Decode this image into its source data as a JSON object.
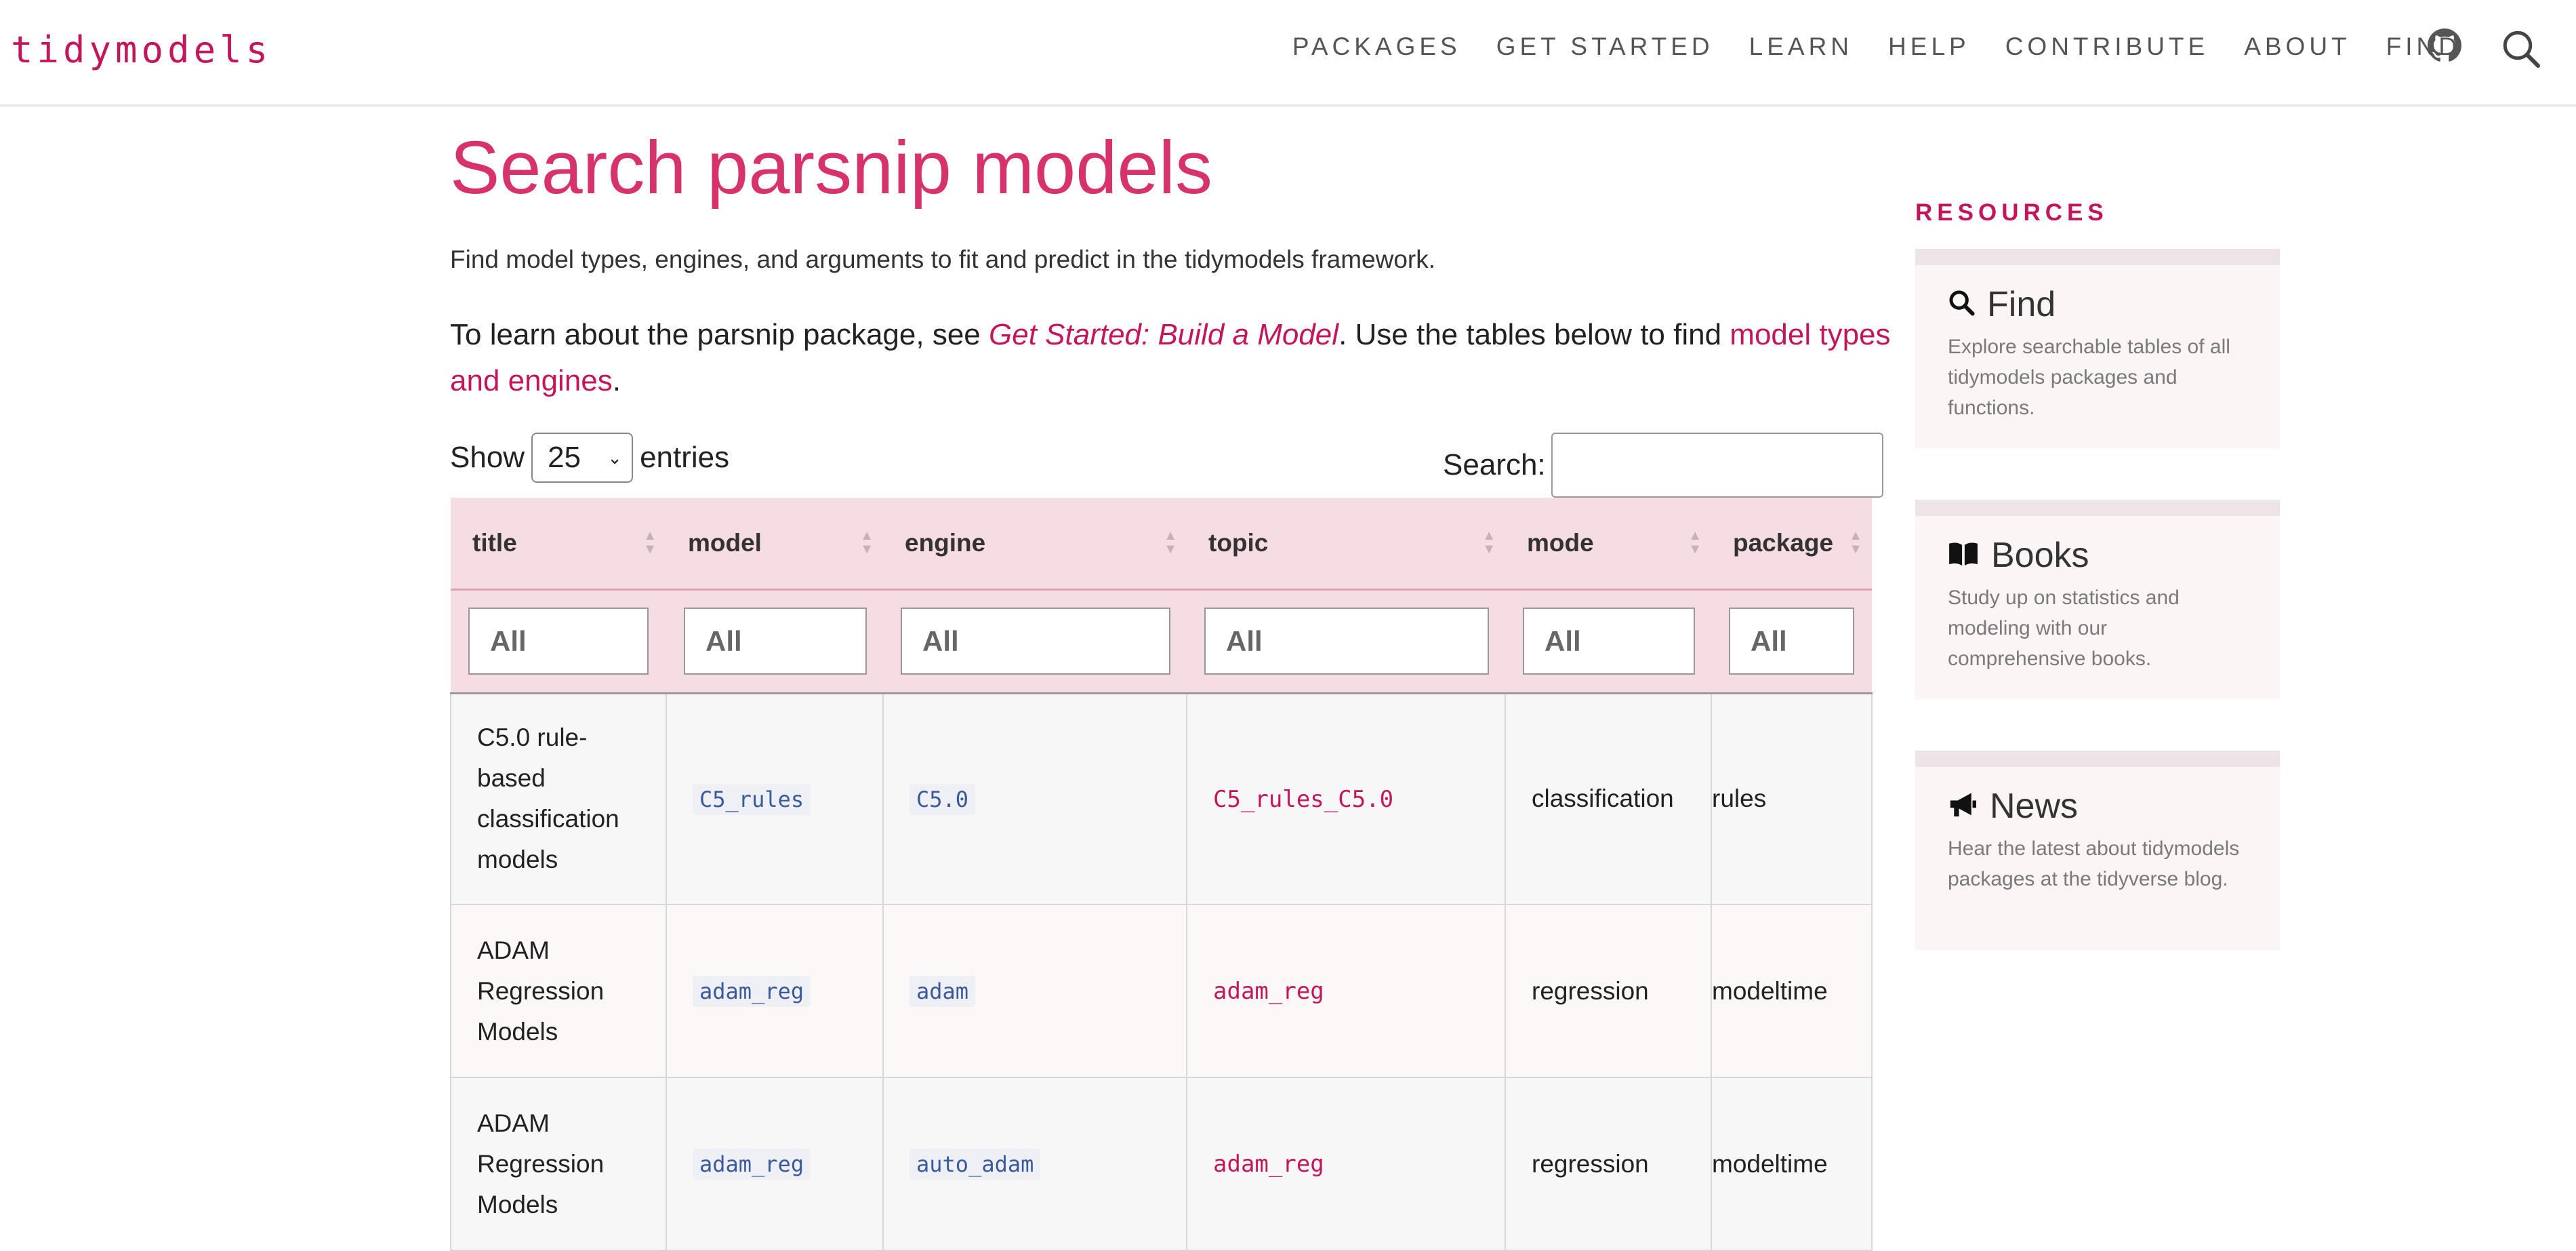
{
  "nav": {
    "brand": "tidymodels",
    "items": [
      "PACKAGES",
      "GET STARTED",
      "LEARN",
      "HELP",
      "CONTRIBUTE",
      "ABOUT",
      "FIND"
    ]
  },
  "page": {
    "title": "Search parsnip models",
    "intro": "Find model types, engines, and arguments to fit and predict in the tidymodels framework.",
    "learn_prefix": "To learn about the parsnip package, see ",
    "learn_link1": "Get Started: Build a Model",
    "learn_middle": ". Use the tables below to find ",
    "learn_link2": "model types and engines",
    "learn_suffix": "."
  },
  "table_controls": {
    "show_label": "Show",
    "entries_value": "25",
    "entries_label": "entries",
    "search_label": "Search:"
  },
  "table": {
    "columns": [
      "title",
      "model",
      "engine",
      "topic",
      "mode",
      "package"
    ],
    "filter_placeholder": "All",
    "rows": [
      {
        "title": "C5.0 rule-based classification models",
        "model": "C5_rules",
        "engine": "C5.0",
        "topic": "C5_rules_C5.0",
        "mode": "classification",
        "package": "rules"
      },
      {
        "title": "ADAM Regression Models",
        "model": "adam_reg",
        "engine": "adam",
        "topic": "adam_reg",
        "mode": "regression",
        "package": "modeltime"
      },
      {
        "title": "ADAM Regression Models",
        "model": "adam_reg",
        "engine": "auto_adam",
        "topic": "adam_reg",
        "mode": "regression",
        "package": "modeltime"
      }
    ]
  },
  "sidebar": {
    "heading": "RESOURCES",
    "cards": [
      {
        "title": "Find",
        "icon": "search-icon",
        "desc": "Explore searchable tables of all tidymodels packages and functions."
      },
      {
        "title": "Books",
        "icon": "book-icon",
        "desc": "Study up on statistics and modeling with our comprehensive books."
      },
      {
        "title": "News",
        "icon": "megaphone-icon",
        "desc": "Hear the latest about tidymodels packages at the tidyverse blog."
      }
    ]
  },
  "colors": {
    "accent": "#c2185b",
    "title": "#d6336c",
    "header_bg": "#f6dde3"
  }
}
